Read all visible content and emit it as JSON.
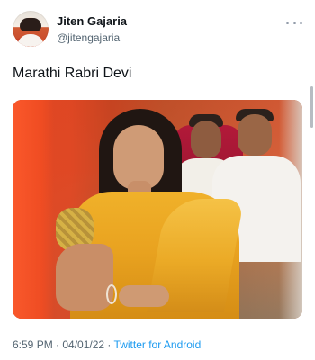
{
  "profile": {
    "display_name": "Jiten Gajaria",
    "handle": "@jitengajaria"
  },
  "tweet": {
    "text": "Marathi Rabri Devi"
  },
  "meta": {
    "time": "6:59 PM",
    "separator_1": " · ",
    "date": "04/01/22",
    "separator_2": " · ",
    "source": "Twitter for Android"
  },
  "icons": {
    "more": "more-icon",
    "avatar": "profile-avatar"
  },
  "colors": {
    "text_primary": "#0f1419",
    "text_secondary": "#536471",
    "link": "#1d9bf0",
    "background": "#ffffff"
  }
}
